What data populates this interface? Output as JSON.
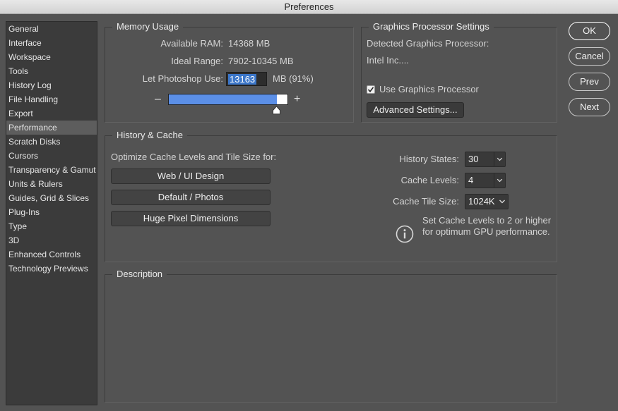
{
  "window": {
    "title": "Preferences"
  },
  "sidebar": {
    "selected": "Performance",
    "items": [
      "General",
      "Interface",
      "Workspace",
      "Tools",
      "History Log",
      "File Handling",
      "Export",
      "Performance",
      "Scratch Disks",
      "Cursors",
      "Transparency & Gamut",
      "Units & Rulers",
      "Guides, Grid & Slices",
      "Plug-Ins",
      "Type",
      "3D",
      "Enhanced Controls",
      "Technology Previews"
    ]
  },
  "memory": {
    "title": "Memory Usage",
    "available_label": "Available RAM:",
    "available_value": "14368 MB",
    "ideal_label": "Ideal Range:",
    "ideal_value": "7902-10345 MB",
    "let_label": "Let Photoshop Use:",
    "let_value": "13163",
    "let_suffix": "MB (91%)",
    "slider_fraction": 0.91,
    "minus": "–",
    "plus": "+"
  },
  "gpu": {
    "title": "Graphics Processor Settings",
    "detected_label": "Detected Graphics Processor:",
    "detected_value": "Intel Inc....",
    "use_label": "Use Graphics Processor",
    "use_checked": true,
    "advanced_button": "Advanced Settings..."
  },
  "history_cache": {
    "title": "History & Cache",
    "optimize_label": "Optimize Cache Levels and Tile Size for:",
    "presets": [
      "Web / UI Design",
      "Default / Photos",
      "Huge Pixel Dimensions"
    ],
    "history_states_label": "History States:",
    "history_states_value": "30",
    "cache_levels_label": "Cache Levels:",
    "cache_levels_value": "4",
    "cache_tile_label": "Cache Tile Size:",
    "cache_tile_value": "1024K",
    "info_line1": "Set Cache Levels to 2 or higher",
    "info_line2": "for optimum GPU performance."
  },
  "description": {
    "title": "Description"
  },
  "buttons": {
    "ok": "OK",
    "cancel": "Cancel",
    "prev": "Prev",
    "next": "Next"
  },
  "colors": {
    "slider_fill": "#5b8fe7",
    "selection": "#3b76c9",
    "background": "#535353"
  }
}
